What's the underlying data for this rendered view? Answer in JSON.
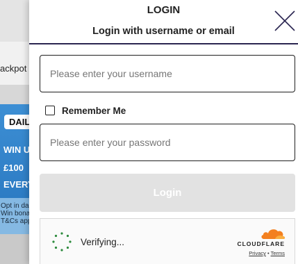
{
  "background": {
    "jackpot_text": "ackpot",
    "daily_badge": "DAIL",
    "promo_lines": [
      "WIN U",
      "£100",
      "EVERY"
    ],
    "terms_lines": [
      "Opt in da",
      "Win bona",
      "T&Cs app"
    ]
  },
  "login": {
    "title": "LOGIN",
    "subtitle": "Login with username or email",
    "username_placeholder": "Please enter your username",
    "remember_label": "Remember Me",
    "password_placeholder": "Please enter your password",
    "login_button": "Login"
  },
  "cloudflare": {
    "status": "Verifying...",
    "brand": "CLOUDFLARE",
    "privacy": "Privacy",
    "separator": "•",
    "terms": "Terms"
  },
  "colors": {
    "divider": "#2a2550",
    "button_disabled": "#e2e2e2",
    "spinner": "#2c8a3c",
    "cloudflare_orange": "#f38020"
  },
  "icons": [
    "close-icon",
    "spinner-icon",
    "cloudflare-logo-icon"
  ]
}
